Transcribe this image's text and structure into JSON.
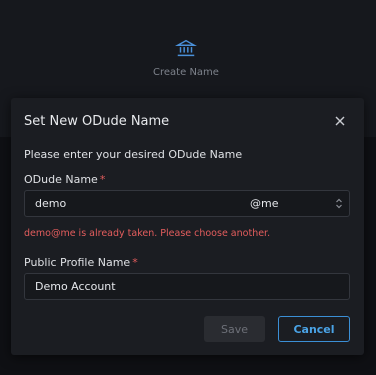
{
  "background": {
    "create_label": "Create Name",
    "create_icon": "bank-icon"
  },
  "modal": {
    "title": "Set New ODude Name",
    "close_icon": "close-icon",
    "description": "Please enter your desired ODude Name",
    "odude_name": {
      "label": "ODude Name",
      "required_mark": "*",
      "value": "demo",
      "suffix_value": "@me",
      "error": "demo@me is already taken. Please choose another."
    },
    "public_profile": {
      "label": "Public Profile Name",
      "required_mark": "*",
      "value": "Demo Account"
    },
    "buttons": {
      "save": "Save",
      "cancel": "Cancel"
    }
  },
  "colors": {
    "accent": "#3b8fd6",
    "error": "#e35d5d",
    "modal_bg": "#1b1d22"
  }
}
